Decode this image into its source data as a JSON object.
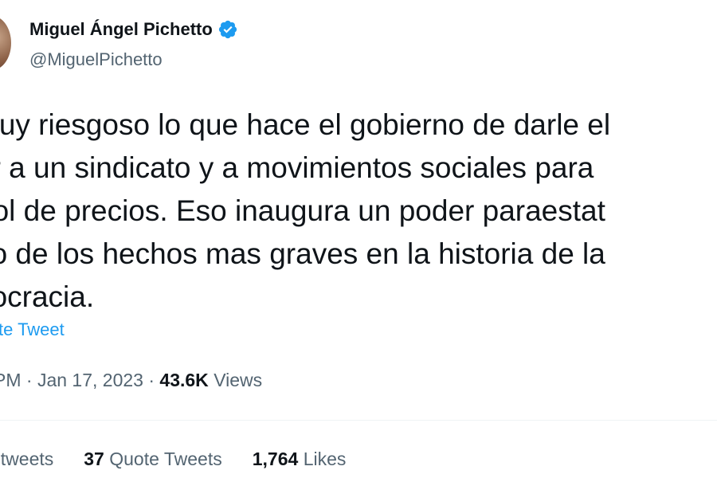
{
  "author": {
    "display_name": "Miguel Ángel Pichetto",
    "handle": "@MiguelPichetto",
    "verified": true
  },
  "tweet": {
    "lines": [
      "muy riesgoso lo que hace el gobierno de darle el",
      "er a un sindicato y a movimientos sociales para",
      "trol de precios. Eso inaugura un poder paraestat",
      "no de los hechos mas graves en la historia de la",
      "nocracia."
    ],
    "translate_label": "te Tweet"
  },
  "meta": {
    "time": "PM",
    "sep1": "·",
    "date": "Jan 17, 2023",
    "sep2": "·",
    "views_count": "43.6K",
    "views_label": "Views"
  },
  "stats": {
    "retweets_label": "etweets",
    "quotes_count": "37",
    "quotes_label": "Quote Tweets",
    "likes_count": "1,764",
    "likes_label": "Likes"
  },
  "colors": {
    "text": "#0f1419",
    "secondary": "#536471",
    "accent": "#1d9bf0",
    "divider": "#eff3f4"
  }
}
